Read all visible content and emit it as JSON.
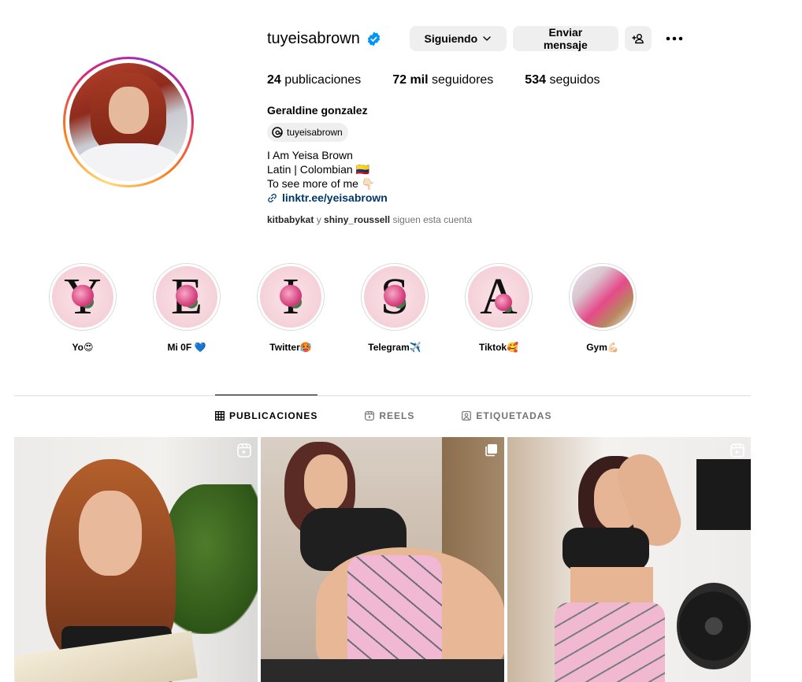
{
  "profile": {
    "username": "tuyeisabrown",
    "verified_icon": "verified-badge-icon",
    "following_label": "Siguiendo",
    "message_label": "Enviar mensaje",
    "full_name": "Geraldine gonzalez",
    "threads_handle": "tuyeisabrown",
    "stats": {
      "posts_count": "24",
      "posts_label": "publicaciones",
      "followers_count": "72 mil",
      "followers_label": "seguidores",
      "following_count": "534",
      "following_label": "seguidos"
    },
    "bio": {
      "line1": "I Am Yeisa Brown",
      "line2": "Latin | Colombian 🇨🇴",
      "line3": "To see more of me 👇🏻",
      "link": "linktr.ee/yeisabrown"
    },
    "followed_by": {
      "user1": "kitbabykat",
      "joiner": "y",
      "user2": "shiny_roussell",
      "suffix": "siguen esta cuenta"
    }
  },
  "highlights": [
    {
      "label": "Yo😍",
      "letter": "Y"
    },
    {
      "label": "Mi 0F 💙",
      "letter": "E"
    },
    {
      "label": "Twitter🥵",
      "letter": "I"
    },
    {
      "label": "Telegram✈️",
      "letter": "S"
    },
    {
      "label": "Tiktok🥰",
      "letter": "A"
    },
    {
      "label": "Gym💪🏻",
      "letter": ""
    }
  ],
  "tabs": [
    {
      "label": "PUBLICACIONES",
      "icon": "grid-icon",
      "active": true
    },
    {
      "label": "REELS",
      "icon": "reels-icon",
      "active": false
    },
    {
      "label": "ETIQUETADAS",
      "icon": "tagged-icon",
      "active": false
    }
  ],
  "posts": [
    {
      "type": "reel",
      "badge_icon": "reel-icon"
    },
    {
      "type": "carousel",
      "badge_icon": "carousel-icon"
    },
    {
      "type": "reel",
      "badge_icon": "reel-icon"
    }
  ],
  "colors": {
    "link": "#00376b",
    "verified": "#0095f6",
    "button_bg": "#efefef",
    "muted": "#737373"
  }
}
